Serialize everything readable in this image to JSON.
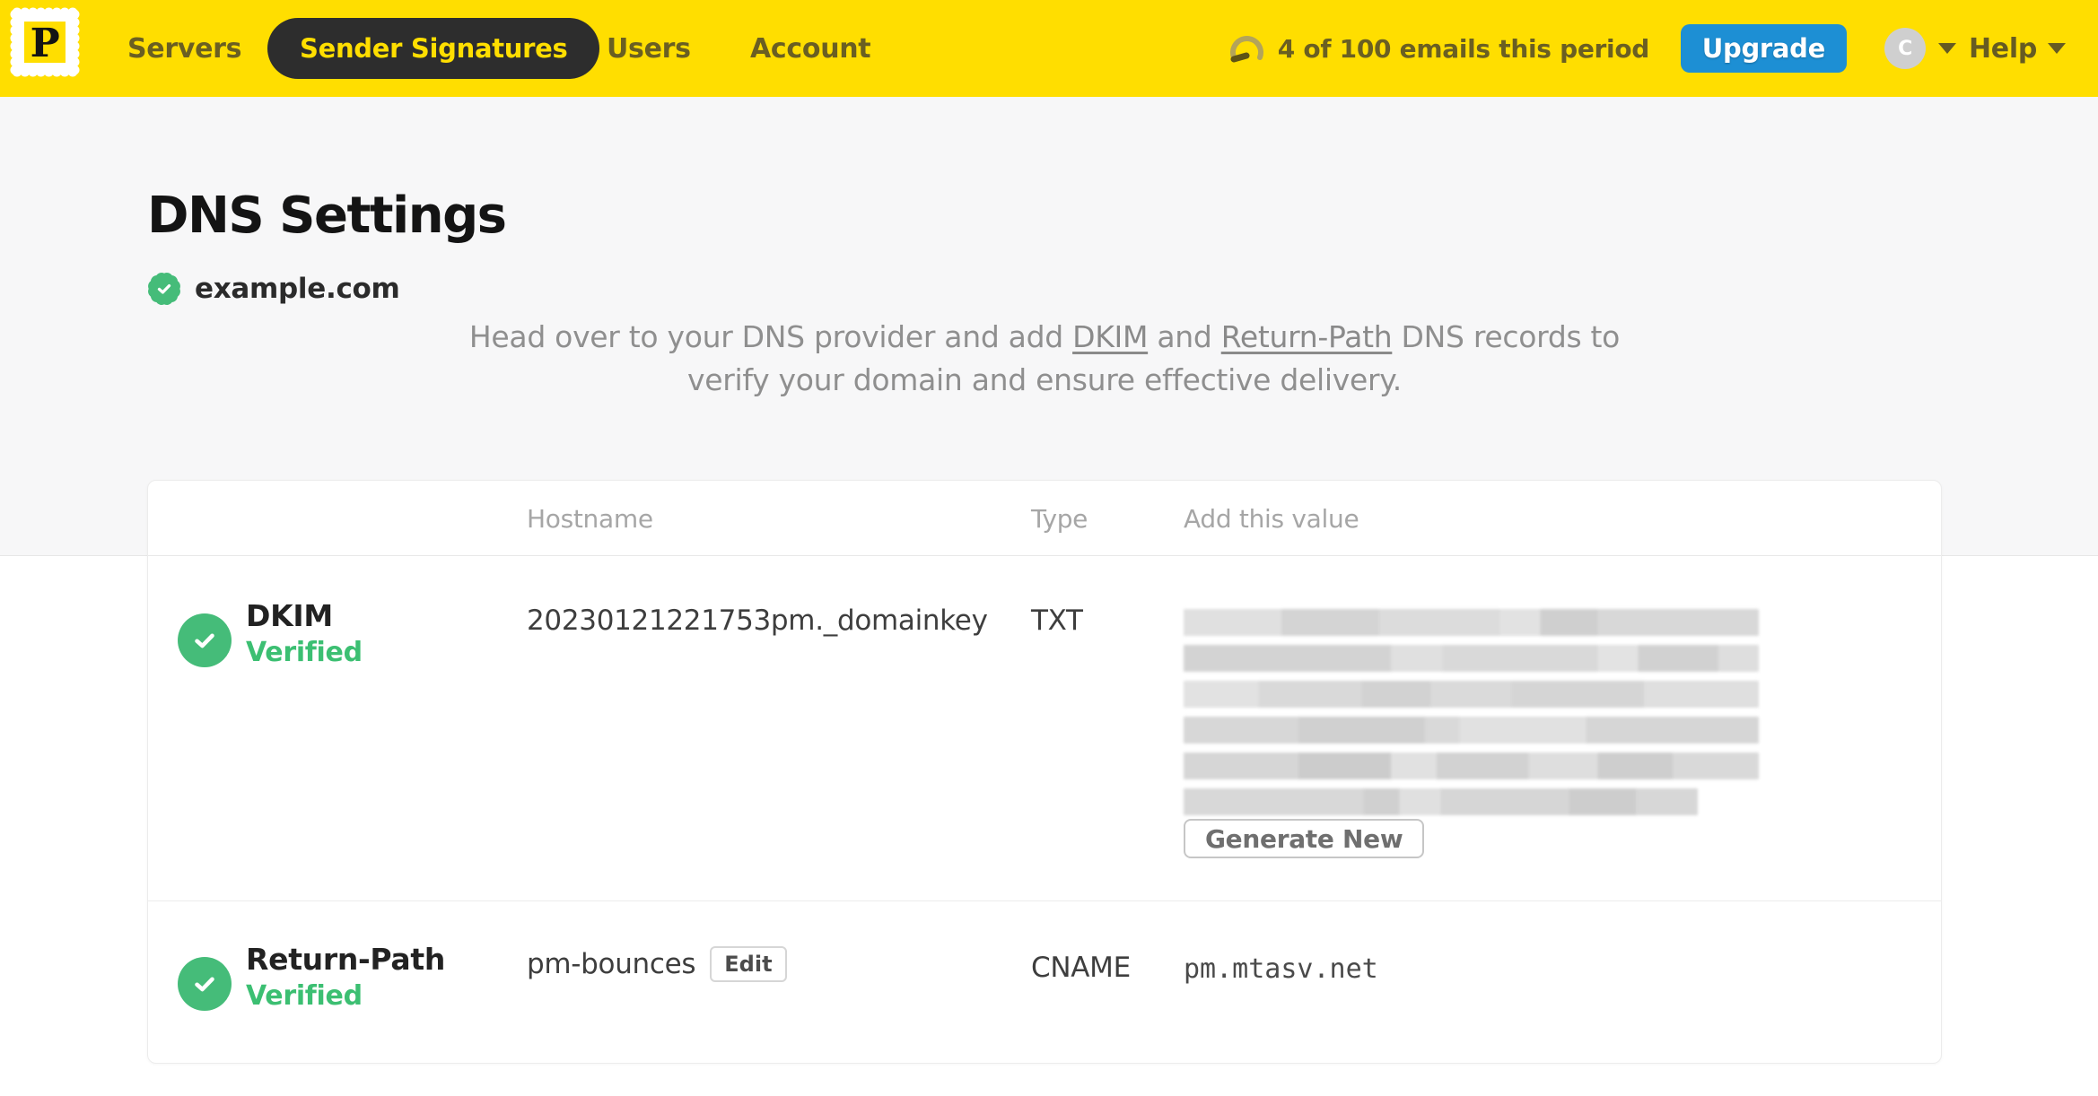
{
  "brand": {
    "logo_letter": "P"
  },
  "nav": {
    "items": [
      {
        "label": "Servers",
        "active": false
      },
      {
        "label": "Sender Signatures",
        "active": true
      },
      {
        "label": "Users",
        "active": false
      },
      {
        "label": "Account",
        "active": false
      }
    ],
    "usage_text": "4 of 100 emails this period",
    "upgrade_label": "Upgrade",
    "avatar_initial": "C",
    "help_label": "Help"
  },
  "page": {
    "title": "DNS Settings",
    "domain": "example.com",
    "domain_verified": true,
    "description": {
      "line1_pre": "Head over to your DNS provider and add ",
      "dkim_link": "DKIM",
      "line1_mid": " and ",
      "return_path_link": "Return-Path",
      "line1_post": " DNS records to",
      "line2": "verify your domain and ensure effective delivery."
    }
  },
  "table": {
    "headers": {
      "hostname": "Hostname",
      "type": "Type",
      "value": "Add this value"
    },
    "rows": [
      {
        "name": "DKIM",
        "status": "Verified",
        "hostname": "20230121221753pm._domainkey",
        "type": "TXT",
        "value_redacted": true,
        "action_label": "Generate New"
      },
      {
        "name": "Return-Path",
        "status": "Verified",
        "hostname": "pm-bounces",
        "edit_label": "Edit",
        "type": "CNAME",
        "value": "pm.mtasv.net"
      }
    ]
  },
  "colors": {
    "brand_yellow": "#FFDE00",
    "nav_pill_bg": "#2d2d2d",
    "upgrade_blue": "#1d8fd4",
    "verified_green": "#45bc79"
  }
}
